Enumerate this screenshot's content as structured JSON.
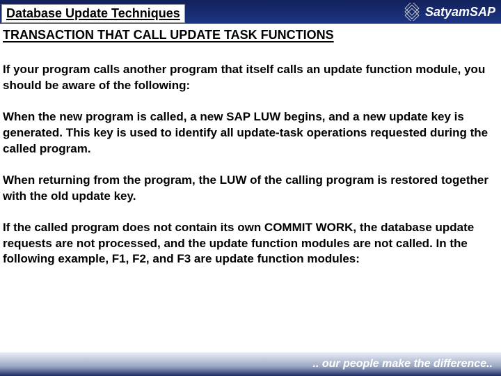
{
  "header": {
    "title": "Database Update Techniques",
    "brand": "Satyam",
    "brand_suffix": "SAP"
  },
  "subtitle": "TRANSACTION THAT CALL UPDATE TASK FUNCTIONS",
  "paragraphs": [
    "If your program calls another program that itself calls an update function module, you should be aware of the following:",
    "When the new program is called, a new SAP LUW begins, and a new update key is generated. This key is used to identify all update-task operations requested during the called program.",
    "When returning from the program, the LUW of the calling program is restored together with the old update key.",
    "If the called program does not contain its own COMMIT WORK, the database update requests are not processed, and the update function modules are not called. In the following example, F1, F2, and F3 are update function modules:"
  ],
  "footer": {
    "tagline": ".. our people make the difference.."
  }
}
